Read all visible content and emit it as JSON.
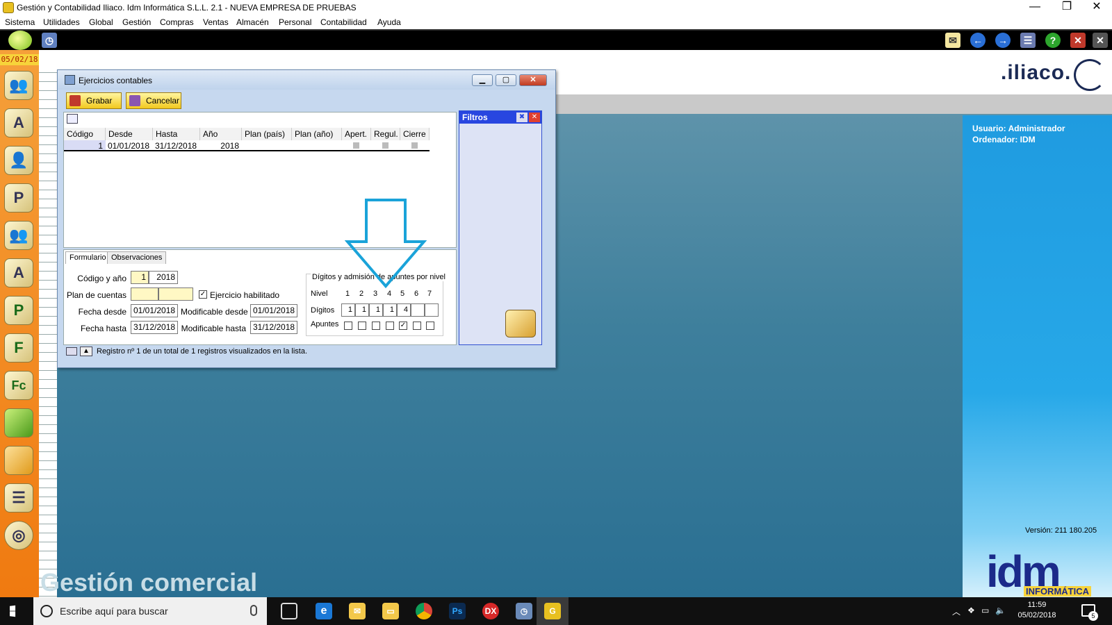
{
  "titlebar": {
    "title": "Gestión y Contabilidad Iliaco. Idm Informática S.L.L. 2.1 - NUEVA EMPRESA DE PRUEBAS",
    "min": "—",
    "restore": "❐",
    "close": "✕"
  },
  "menu": [
    "Sistema",
    "Utilidades",
    "Global",
    "Gestión",
    "Compras",
    "Ventas",
    "Almacén",
    "Personal",
    "Contabilidad",
    "Ayuda"
  ],
  "sidebar": {
    "date": "05/02/18",
    "icons": [
      "users-icon",
      "assets-icon",
      "user-icon",
      "user-p-icon",
      "users-2-icon",
      "user-a-icon",
      "p-document-icon",
      "f-document-icon",
      "fc-document-icon",
      "green-bag-icon",
      "orange-bag-icon",
      "ledger-icon",
      "cd-wand-icon"
    ]
  },
  "brand": {
    "iliaco": ".iliaco.",
    "footer_text": "Gestión comercial"
  },
  "user_panel": {
    "user_label": "Usuario: Administrador",
    "computer_label": "Ordenador:  IDM",
    "version": "Versión: 211 180.205",
    "idm": "idm",
    "idm_sub": "INFORMÁTICA"
  },
  "window": {
    "title": "Ejercicios contables",
    "buttons": {
      "save": "Grabar",
      "cancel": "Cancelar"
    },
    "grid": {
      "columns": [
        "Código",
        "Desde",
        "Hasta",
        "Año",
        "Plan (país)",
        "Plan (año)",
        "Apert.",
        "Regul.",
        "Cierre"
      ],
      "row": {
        "codigo": "1",
        "desde": "01/01/2018",
        "hasta": "31/12/2018",
        "anio": "2018"
      }
    },
    "filters_title": "Filtros",
    "tabs": [
      "Formulario",
      "Observaciones"
    ],
    "form": {
      "codigo_label": "Código y año",
      "codigo_value": "1",
      "anio_value": "2018",
      "plan_label": "Plan de cuentas",
      "ejercicio_label": "Ejercicio habilitado",
      "fecha_desde_label": "Fecha desde",
      "fecha_desde": "01/01/2018",
      "mod_desde_label": "Modificable desde",
      "mod_desde": "01/01/2018",
      "fecha_hasta_label": "Fecha hasta",
      "fecha_hasta": "31/12/2018",
      "mod_hasta_label": "Modificable hasta",
      "mod_hasta": "31/12/2018"
    },
    "digits_group": {
      "title": "Dígitos y admisión de apuntes por nivel",
      "nivel_label": "Nivel",
      "digitos_label": "Dígitos",
      "apuntes_label": "Apuntes",
      "levels": [
        "1",
        "2",
        "3",
        "4",
        "5",
        "6",
        "7"
      ],
      "digits": [
        "1",
        "1",
        "1",
        "1",
        "4",
        "",
        ""
      ],
      "apuntes_checked": [
        false,
        false,
        false,
        false,
        true,
        false,
        false
      ]
    },
    "status": "Registro nº 1 de un total de 1 registros visualizados en la lista."
  },
  "taskbar": {
    "search_placeholder": "Escribe aquí para buscar",
    "time": "11:59",
    "date": "05/02/2018",
    "notifications": "5"
  },
  "colors": {
    "accent_orange": "#f07a10",
    "window_bg": "#c6d8ef",
    "filters_header": "#2846e0",
    "arrow": "#1aa3d9"
  }
}
